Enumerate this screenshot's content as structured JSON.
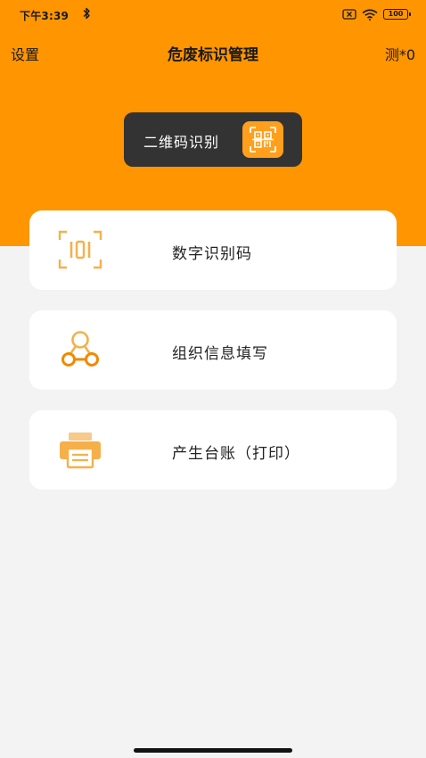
{
  "status_bar": {
    "time": "下午3:39",
    "bluetooth_icon": "bluetooth-icon",
    "sim_icon": "no-sim-icon",
    "wifi_icon": "wifi-icon",
    "battery_level": "100"
  },
  "nav": {
    "left_label": "设置",
    "title": "危废标识管理",
    "right_label": "测*0"
  },
  "qr_button": {
    "label": "二维码识别",
    "icon": "qr-scan-icon"
  },
  "menu": {
    "items": [
      {
        "label": "数字识别码",
        "icon": "digit-scan-icon"
      },
      {
        "label": "组织信息填写",
        "icon": "organization-icon"
      },
      {
        "label": "产生台账（打印）",
        "icon": "printer-icon"
      }
    ]
  },
  "colors": {
    "accent": "#ff9500",
    "icon_orange": "#f5a623",
    "pill_dark": "#333333",
    "background": "#f3f3f3"
  }
}
